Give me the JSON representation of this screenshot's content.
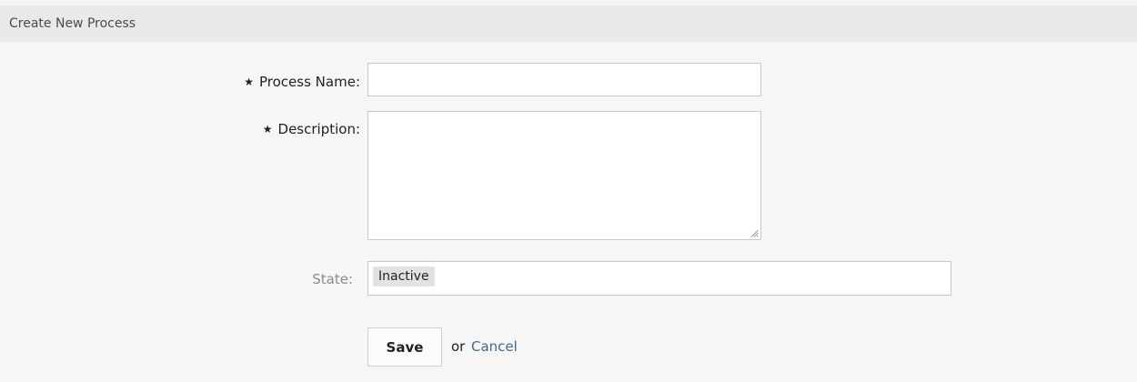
{
  "panel": {
    "title": "Create New Process"
  },
  "form": {
    "process_name": {
      "label": "Process Name:",
      "required": true,
      "value": ""
    },
    "description": {
      "label": "Description:",
      "required": true,
      "value": ""
    },
    "state": {
      "label": "State:",
      "value": "Inactive"
    }
  },
  "actions": {
    "save_label": "Save",
    "or_text": "or",
    "cancel_label": "Cancel"
  },
  "colors": {
    "panel_bg": "#f6f6f6",
    "header_bg": "#e9e9e9",
    "link": "#3d6d8a",
    "muted_label": "#8a8a8a"
  },
  "icons": {
    "required": "star-icon",
    "resize": "resize-grip-icon"
  }
}
